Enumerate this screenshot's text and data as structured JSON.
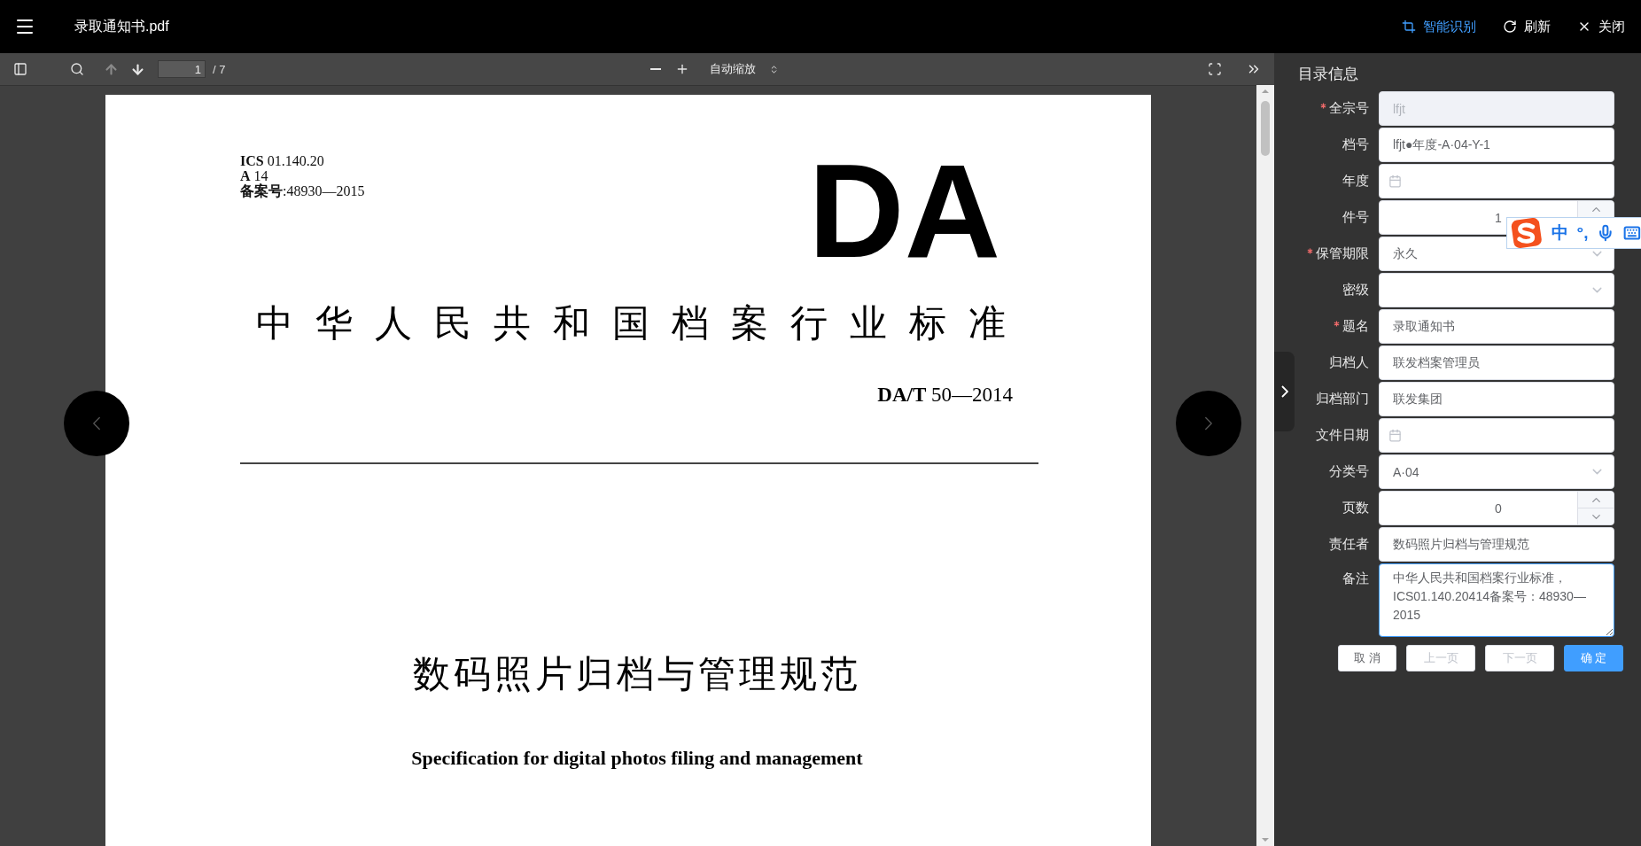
{
  "top_bar": {
    "title": "录取通知书.pdf",
    "actions": [
      {
        "kind": "ocr",
        "label": "智能识别",
        "active": true
      },
      {
        "kind": "refresh",
        "label": "刷新",
        "active": false
      },
      {
        "kind": "close",
        "label": "关闭",
        "active": false
      }
    ]
  },
  "pdf_toolbar": {
    "page": "1",
    "page_count": "/ 7",
    "zoom": "自动缩放",
    "prev_disabled": true
  },
  "document": {
    "header_lines": [
      "**ICS** 01.140.20",
      "**A** 14",
      "**备案号**:48930—2015"
    ],
    "logo": "DA",
    "standard_title": "中华人民共和国档案行业标准",
    "standard_number": "**DA/T** 50—2014",
    "title": "数码照片归档与管理规范",
    "subtitle": "Specification for digital photos filing and management"
  },
  "form": {
    "title": "目录信息",
    "fields": [
      {
        "label": "全宗号",
        "kind": "text",
        "value": "lfjt",
        "required": true,
        "disabled": true
      },
      {
        "label": "档号",
        "kind": "text",
        "value": "lfjt●年度-A·04-Y-1",
        "required": false,
        "disabled": false
      },
      {
        "label": "年度",
        "kind": "date",
        "required": false,
        "disabled": false
      },
      {
        "label": "件号",
        "kind": "number",
        "value": "1",
        "required": false,
        "disabled": false
      },
      {
        "label": "保管期限",
        "kind": "select",
        "value": "永久",
        "required": true,
        "disabled": false
      },
      {
        "label": "密级",
        "kind": "select",
        "required": false,
        "disabled": false
      },
      {
        "label": "题名",
        "kind": "text",
        "value": "录取通知书",
        "required": true,
        "disabled": false
      },
      {
        "label": "归档人",
        "kind": "text",
        "value": "联发档案管理员",
        "required": false,
        "disabled": false
      },
      {
        "label": "归档部门",
        "kind": "text",
        "value": "联发集团",
        "required": false,
        "disabled": false
      },
      {
        "label": "文件日期",
        "kind": "date",
        "required": false,
        "disabled": false
      },
      {
        "label": "分类号",
        "kind": "select",
        "value": "A·04",
        "required": false,
        "disabled": false
      },
      {
        "label": "页数",
        "kind": "number",
        "value": "0",
        "required": false,
        "disabled": false
      },
      {
        "label": "责任者",
        "kind": "text",
        "value": "数码照片归档与管理规范",
        "required": false,
        "disabled": false
      },
      {
        "label": "备注",
        "kind": "textarea",
        "value": "中华人民共和国档案行业标准，ICS01.140.20414备案号：48930—2015",
        "required": false,
        "disabled": false,
        "focused": true
      }
    ],
    "buttons": [
      {
        "label": "取 消",
        "kind": "default",
        "disabled": false
      },
      {
        "label": "上一页",
        "kind": "default",
        "disabled": true
      },
      {
        "label": "下一页",
        "kind": "default",
        "disabled": true
      },
      {
        "label": "确 定",
        "kind": "primary",
        "disabled": false
      }
    ]
  },
  "ime": {
    "mode": "中",
    "punctuation": "°,"
  }
}
